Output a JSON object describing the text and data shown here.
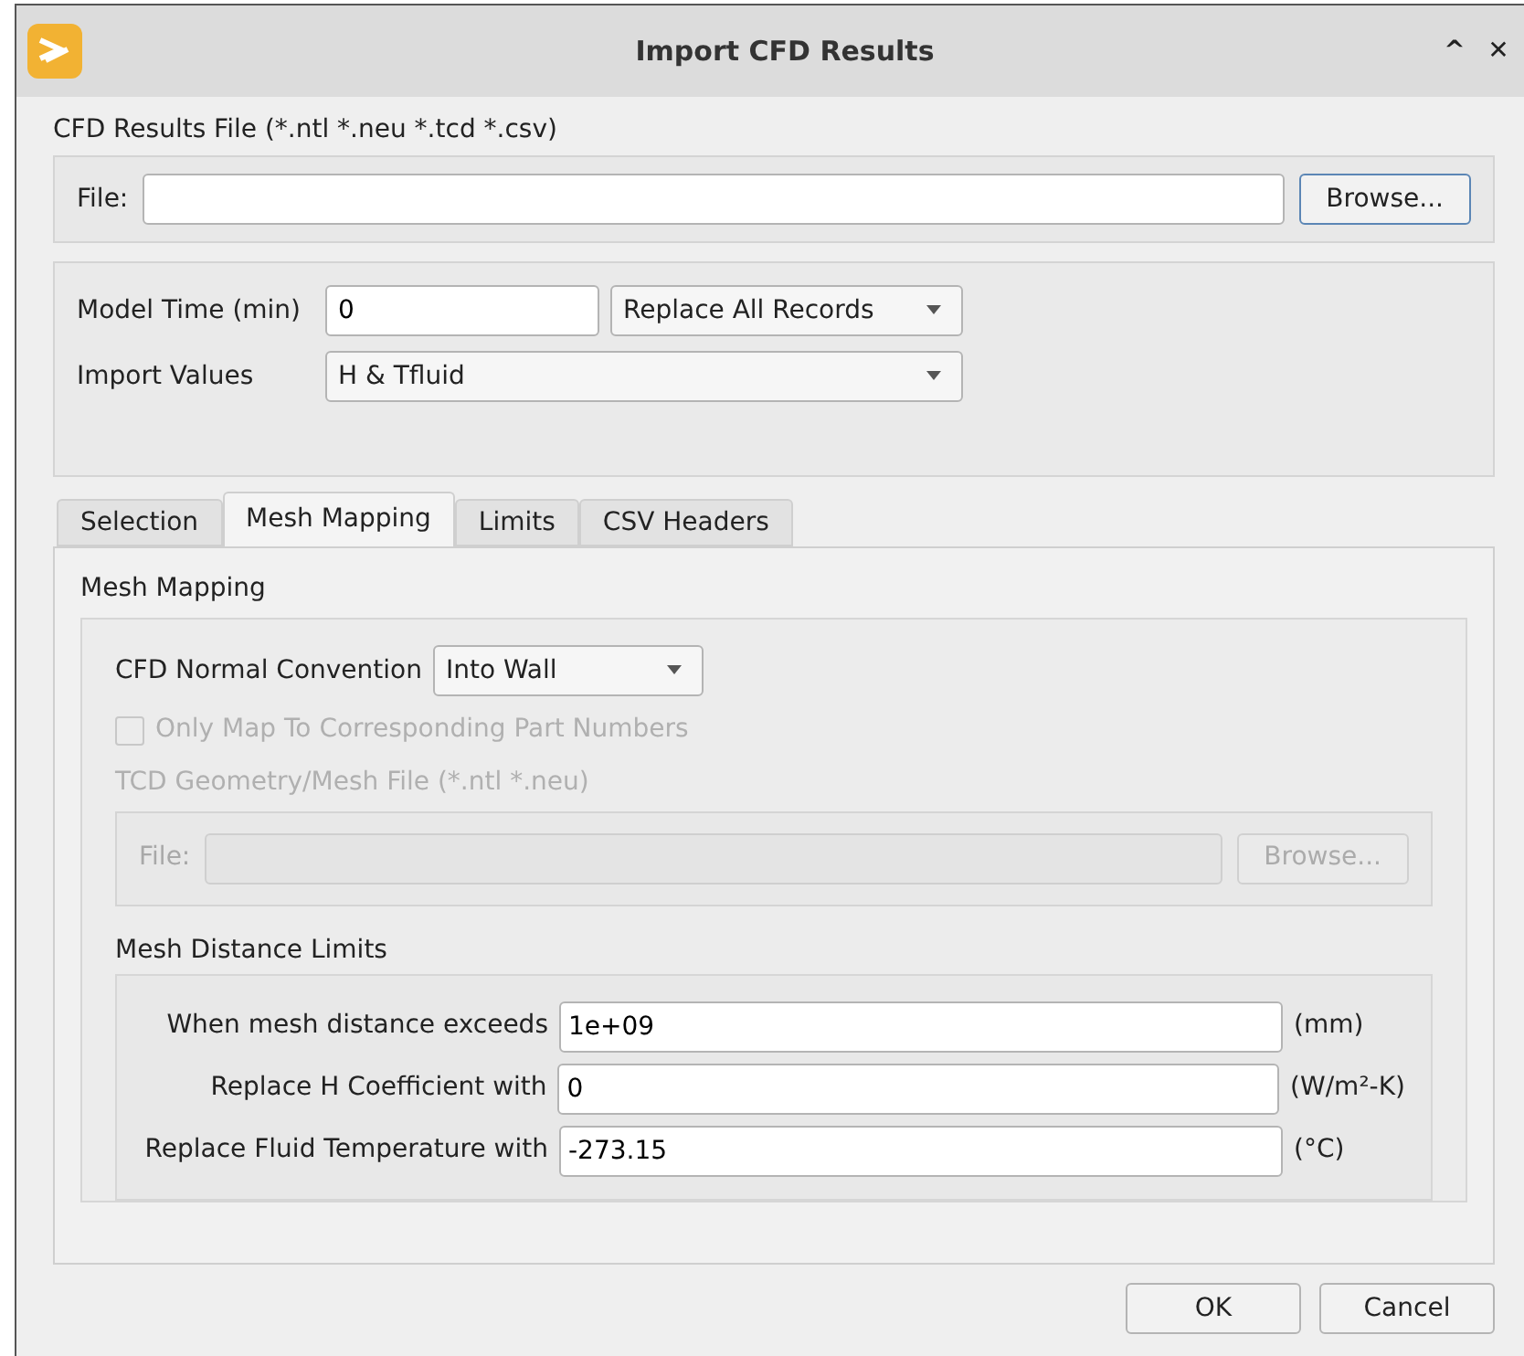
{
  "window": {
    "title": "Import CFD Results",
    "controls": [
      "^",
      "✕"
    ]
  },
  "results_file": {
    "label": "CFD Results File (*.ntl *.neu *.tcd *.csv)",
    "file_label": "File:",
    "browse": "Browse...",
    "disabled": false
  },
  "model_time": {
    "label": "Model Time (min)",
    "value": "0",
    "mode": "Replace All Records"
  },
  "import_values": {
    "label": "Import Values",
    "value": "H & Tfluid"
  },
  "tabs": [
    {
      "label": "Selection",
      "selected": false
    },
    {
      "label": "Mesh Mapping",
      "selected": true
    },
    {
      "label": "Limits",
      "selected": false
    },
    {
      "label": "CSV Headers",
      "selected": false
    }
  ],
  "mesh_mapping": {
    "title": "Mesh Mapping",
    "normal_label": "CFD Normal Convention",
    "normal_value": "Into Wall",
    "only_map": {
      "label": "Only Map To Corresponding Part Numbers",
      "checked": false,
      "disabled": true
    },
    "geometry_file": {
      "label": "TCD Geometry/Mesh File (*.ntl *.neu)",
      "file_label": "File:",
      "browse": "Browse...",
      "disabled": true
    }
  },
  "distance_limits": {
    "title": "Mesh Distance Limits",
    "rows": [
      {
        "label": "When mesh distance exceeds",
        "value": "1e+09",
        "unit": "(mm)"
      },
      {
        "label": "Replace H Coefficient with",
        "value": "0",
        "unit": "(W/m²-K)"
      },
      {
        "label": "Replace Fluid Temperature with",
        "value": "-273.15",
        "unit": "(°C)"
      }
    ]
  },
  "buttons": [
    "OK",
    "Cancel"
  ]
}
